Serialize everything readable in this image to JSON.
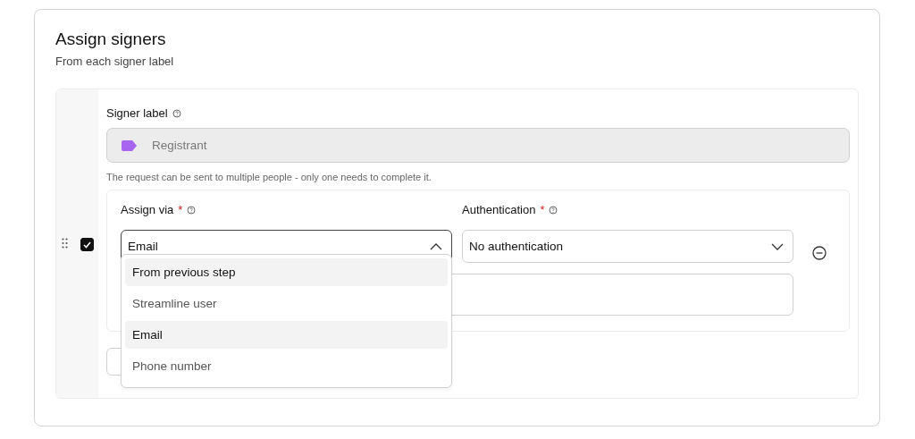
{
  "title": "Assign signers",
  "subtitle": "From each signer label",
  "signer": {
    "checked": true,
    "label": "Signer label",
    "value": "Registrant",
    "disabled": true,
    "help": "The request can be sent to multiple people - only one needs to complete it."
  },
  "assign_via": {
    "label": "Assign via",
    "required_mark": "*",
    "value": "Email",
    "expanded": true,
    "options": [
      {
        "label": "From previous step",
        "highlighted": true
      },
      {
        "label": "Streamline user",
        "highlighted": false
      },
      {
        "label": "Email",
        "highlighted": true
      },
      {
        "label": "Phone number",
        "highlighted": false
      }
    ]
  },
  "authentication": {
    "label": "Authentication",
    "required_mark": "*",
    "value": "No authentication",
    "expanded": false
  }
}
